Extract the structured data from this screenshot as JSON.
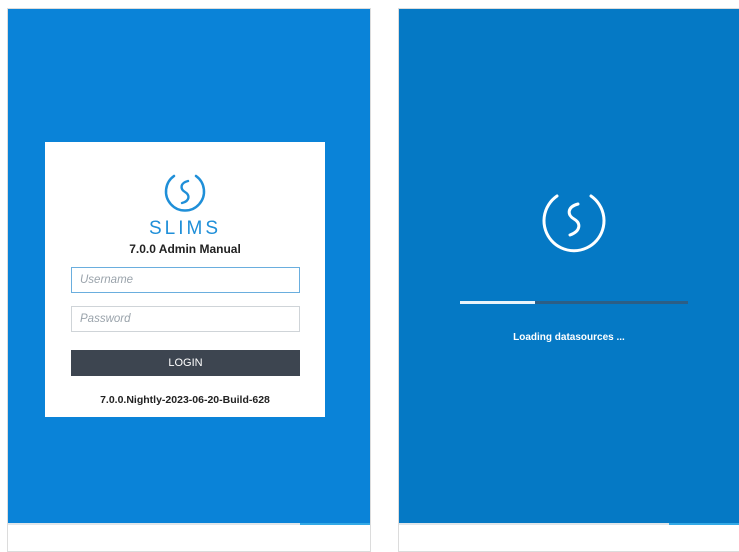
{
  "colors": {
    "login_background": "#0a83d8",
    "loading_background": "#0579c5",
    "brand_blue": "#1f8fd8",
    "button_dark": "#3d4550"
  },
  "login": {
    "brand": "SLIMS",
    "subtitle": "7.0.0 Admin Manual",
    "username_placeholder": "Username",
    "username_value": "",
    "password_placeholder": "Password",
    "password_value": "",
    "login_button": "LOGIN",
    "build": "7.0.0.Nightly-2023-06-20-Build-628",
    "logo_icon": "slims-logo-icon"
  },
  "loading": {
    "text": "Loading datasources ...",
    "progress": 0.33,
    "logo_icon": "slims-logo-icon"
  }
}
